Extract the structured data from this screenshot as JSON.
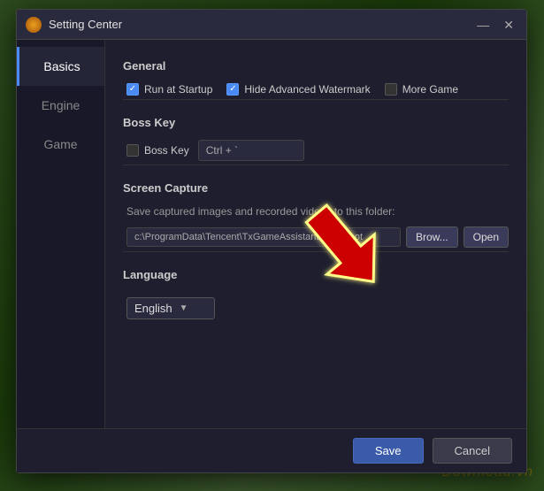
{
  "window": {
    "title": "Setting Center",
    "icon": "settings-icon"
  },
  "titlebar": {
    "minimize": "—",
    "close": "✕"
  },
  "sidebar": {
    "items": [
      {
        "label": "Basics",
        "active": true
      },
      {
        "label": "Engine",
        "active": false
      },
      {
        "label": "Game",
        "active": false
      }
    ]
  },
  "sections": {
    "general": {
      "title": "General",
      "options": [
        {
          "label": "Run at Startup",
          "checked": true
        },
        {
          "label": "Hide Advanced Watermark",
          "checked": true
        },
        {
          "label": "More Game",
          "checked": false
        }
      ]
    },
    "bossKey": {
      "title": "Boss Key",
      "checkbox_label": "Boss Key",
      "checked": false,
      "shortcut": "Ctrl + `"
    },
    "screenCapture": {
      "title": "Screen Capture",
      "description": "Save captured images and recorded videos to this folder:",
      "path": "c:\\ProgramData\\Tencent\\TxGameAssistant\\Snapshot",
      "browse_label": "Brow...",
      "open_label": "Open"
    },
    "language": {
      "title": "Language",
      "selected": "English"
    }
  },
  "footer": {
    "save_label": "Save",
    "cancel_label": "Cancel"
  },
  "watermark": "Download.vn"
}
